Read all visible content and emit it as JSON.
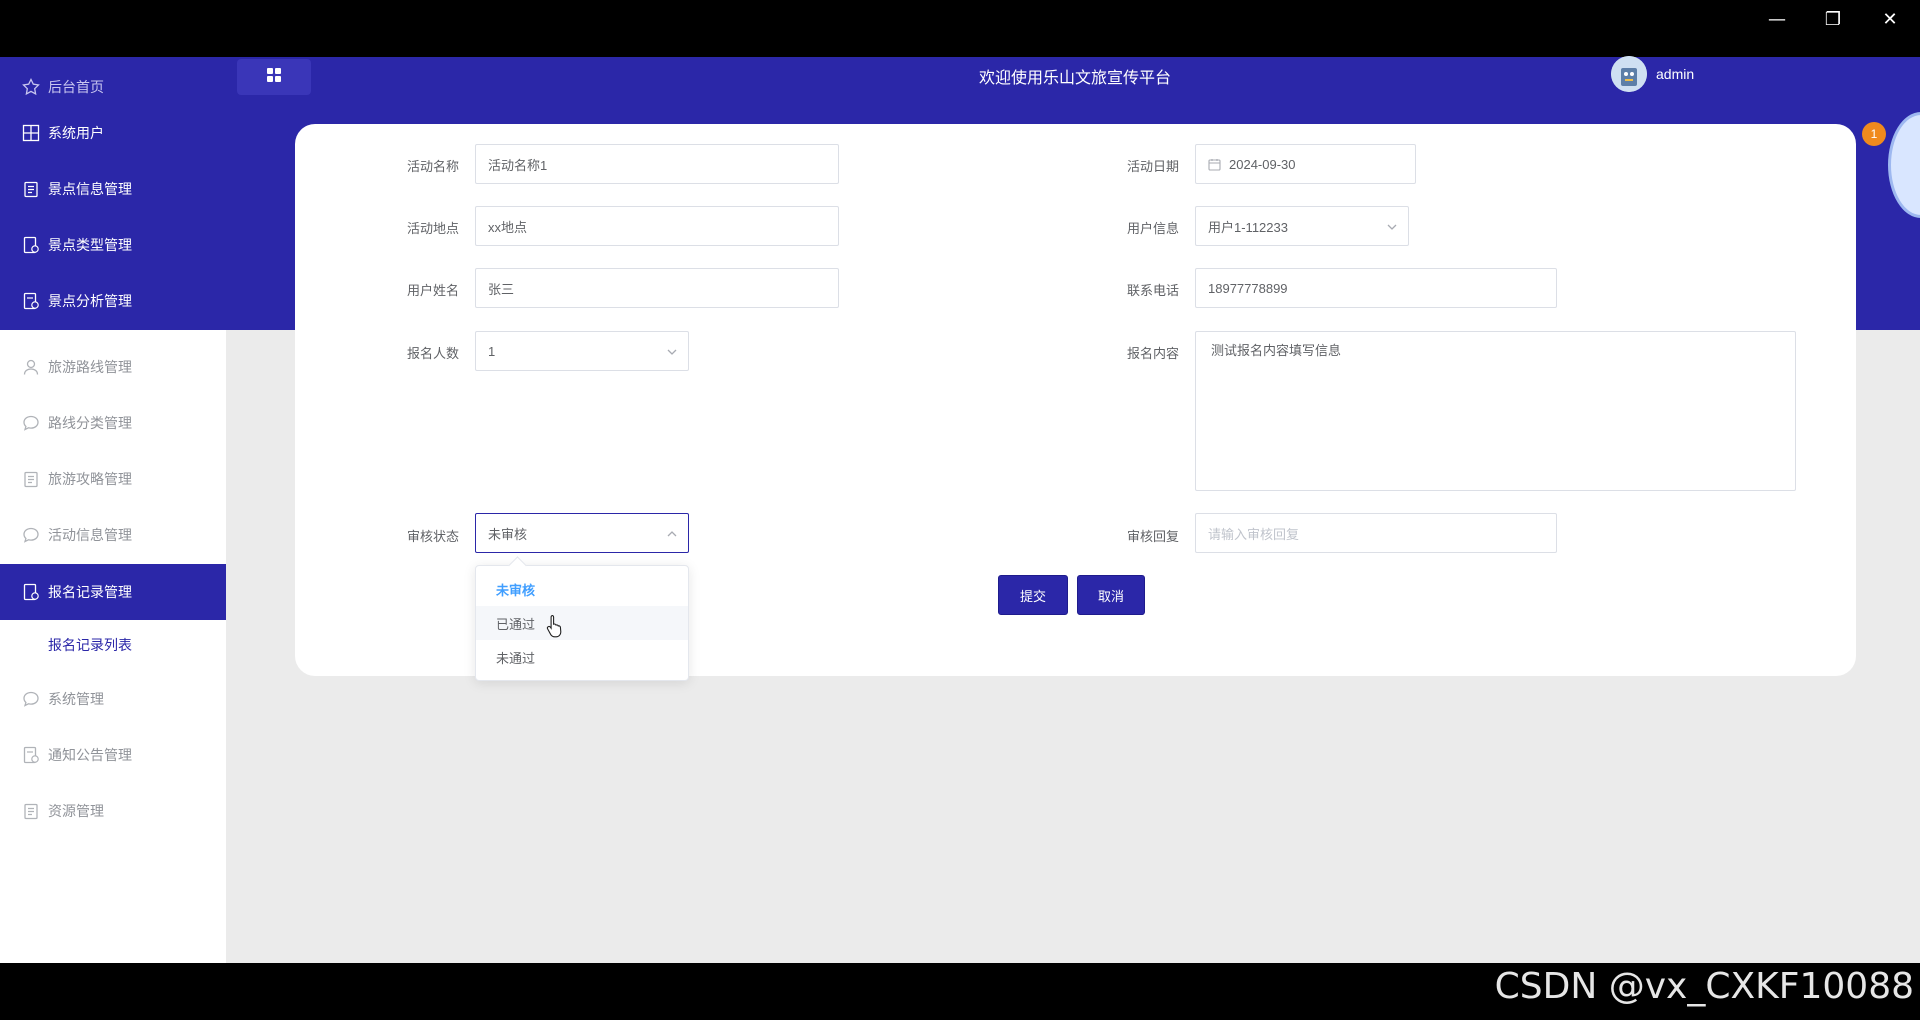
{
  "header": {
    "title": "欢迎使用乐山文旅宣传平台",
    "username": "admin"
  },
  "sidebar": {
    "items": [
      {
        "label": "后台首页",
        "icon": "star-icon"
      },
      {
        "label": "系统用户",
        "icon": "grid-icon"
      },
      {
        "label": "景点信息管理",
        "icon": "clipboard-icon"
      },
      {
        "label": "景点类型管理",
        "icon": "doc-check-icon"
      },
      {
        "label": "景点分析管理",
        "icon": "doc-chart-icon"
      },
      {
        "label": "旅游路线管理",
        "icon": "user-icon"
      },
      {
        "label": "路线分类管理",
        "icon": "chat-icon"
      },
      {
        "label": "旅游攻略管理",
        "icon": "clipboard-icon"
      },
      {
        "label": "活动信息管理",
        "icon": "chat-icon"
      },
      {
        "label": "报名记录管理",
        "icon": "doc-check-icon"
      },
      {
        "label": "系统管理",
        "icon": "chat-icon"
      },
      {
        "label": "通知公告管理",
        "icon": "doc-chart-icon"
      },
      {
        "label": "资源管理",
        "icon": "clipboard-icon"
      }
    ],
    "sub_item": "报名记录列表"
  },
  "form": {
    "activity_name": {
      "label": "活动名称",
      "value": "活动名称1"
    },
    "activity_date": {
      "label": "活动日期",
      "value": "2024-09-30"
    },
    "activity_location": {
      "label": "活动地点",
      "value": "xx地点"
    },
    "user_info": {
      "label": "用户信息",
      "value": "用户1-112233"
    },
    "user_name": {
      "label": "用户姓名",
      "value": "张三"
    },
    "phone": {
      "label": "联系电话",
      "value": "18977778899"
    },
    "signup_count": {
      "label": "报名人数",
      "value": "1"
    },
    "signup_content": {
      "label": "报名内容",
      "value": "测试报名内容填写信息"
    },
    "review_status": {
      "label": "审核状态",
      "value": "未审核"
    },
    "review_reply": {
      "label": "审核回复",
      "placeholder": "请输入审核回复"
    }
  },
  "dropdown": {
    "options": [
      "未审核",
      "已通过",
      "未通过"
    ],
    "selected": "未审核",
    "hovered": "已通过"
  },
  "buttons": {
    "submit": "提交",
    "cancel": "取消"
  },
  "badge_count": "1",
  "watermark": "CSDN @vx_CXKF10088",
  "colors": {
    "primary": "#2b27a8",
    "selected_option": "#409eff",
    "badge": "#f08a1d"
  }
}
